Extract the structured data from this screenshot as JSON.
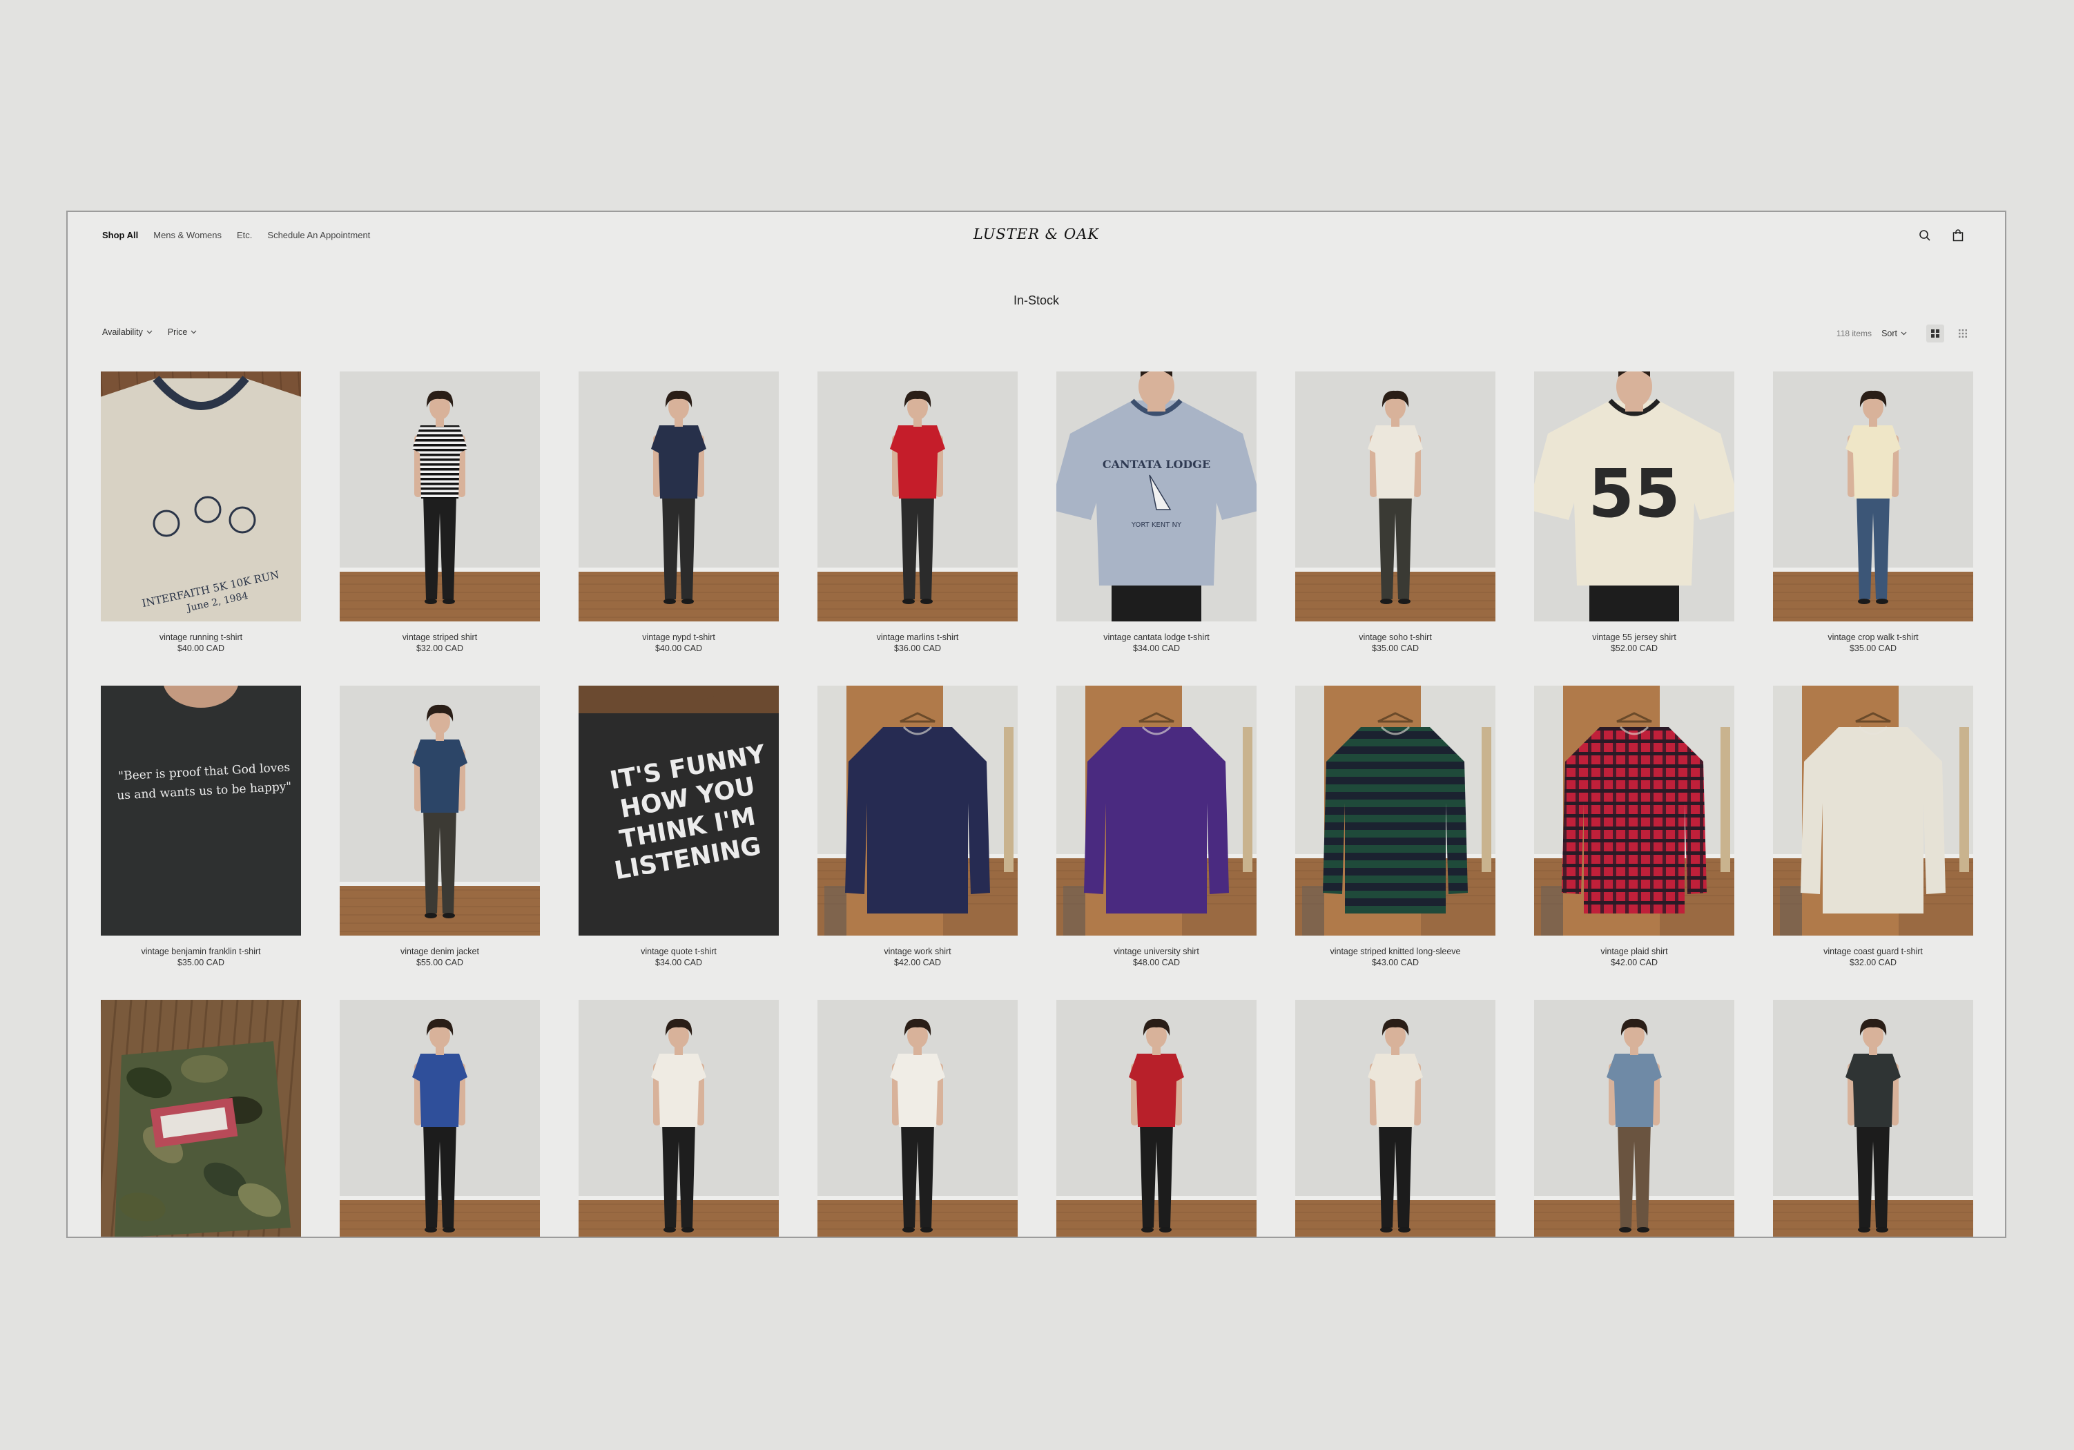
{
  "nav": {
    "items": [
      "Shop All",
      "Mens & Womens",
      "Etc.",
      "Schedule An Appointment"
    ],
    "logo": "LUSTER & OAK"
  },
  "header": {
    "icons": [
      "search-icon",
      "bag-icon"
    ]
  },
  "page": {
    "title": "In-Stock"
  },
  "toolbar": {
    "filters": [
      "Availability",
      "Price"
    ],
    "count": "118 items",
    "sort": "Sort",
    "views": [
      "grid-large-icon",
      "grid-small-icon"
    ]
  },
  "colors": {
    "wall": "#d9d9d6",
    "floor": "#9a6a42",
    "wood_board": "#8a6040",
    "post": "#b07a4a"
  },
  "products": [
    {
      "name": "vintage running t-shirt",
      "price": "$40.00 CAD",
      "scene": "flat",
      "shirt": "#d8d2c4",
      "trim": "#2b3548",
      "print": "INTERFAITH 5K 10K RUN",
      "print2": "June 2, 1984"
    },
    {
      "name": "vintage striped shirt",
      "price": "$32.00 CAD",
      "scene": "model",
      "shirt": "stripes",
      "pants": "#1e1e1e"
    },
    {
      "name": "vintage nypd t-shirt",
      "price": "$40.00 CAD",
      "scene": "model",
      "shirt": "#27304a",
      "pants": "#2b2b2b"
    },
    {
      "name": "vintage marlins t-shirt",
      "price": "$36.00 CAD",
      "scene": "model",
      "shirt": "#c51d2a",
      "pants": "#2b2b2b"
    },
    {
      "name": "vintage cantata lodge t-shirt",
      "price": "$34.00 CAD",
      "scene": "closeup",
      "shirt": "#a9b4c6",
      "trim": "#3c4f6e",
      "print": "CANTATA LODGE",
      "print2": "YORT KENT NY"
    },
    {
      "name": "vintage soho t-shirt",
      "price": "$35.00 CAD",
      "scene": "model",
      "shirt": "#ece7dc",
      "pants": "#3a3a34"
    },
    {
      "name": "vintage 55 jersey shirt",
      "price": "$52.00 CAD",
      "scene": "closeup",
      "shirt": "#ece6d4",
      "trim": "#222222",
      "print": "55",
      "print2": ""
    },
    {
      "name": "vintage crop walk t-shirt",
      "price": "$35.00 CAD",
      "scene": "model",
      "shirt": "#efe6c7",
      "pants": "#3c5677"
    },
    {
      "name": "vintage benjamin franklin t-shirt",
      "price": "$35.00 CAD",
      "scene": "flat-dark",
      "shirt": "#2e3030",
      "trim": "#2e3030",
      "print": "\"Beer is proof that God loves",
      "print2": "us and wants us to be happy\""
    },
    {
      "name": "vintage denim jacket",
      "price": "$55.00 CAD",
      "scene": "model",
      "shirt": "#2c4567",
      "pants": "#3c3a34"
    },
    {
      "name": "vintage quote t-shirt",
      "price": "$34.00 CAD",
      "scene": "flat-dark",
      "shirt": "#2b2b2b",
      "trim": "#2b2b2b",
      "print": "IT'S FUNNY HOW YOU",
      "print2": "THINK I'M LISTENING"
    },
    {
      "name": "vintage work shirt",
      "price": "$42.00 CAD",
      "scene": "hanger",
      "shirt": "#262b52"
    },
    {
      "name": "vintage university shirt",
      "price": "$48.00 CAD",
      "scene": "hanger",
      "shirt": "#4a2a80"
    },
    {
      "name": "vintage striped knitted long-sleeve",
      "price": "$43.00 CAD",
      "scene": "hanger",
      "shirt": "knit"
    },
    {
      "name": "vintage plaid shirt",
      "price": "$42.00 CAD",
      "scene": "hanger",
      "shirt": "plaid"
    },
    {
      "name": "vintage coast guard t-shirt",
      "price": "$32.00 CAD",
      "scene": "hanger",
      "shirt": "#e6e2d6"
    },
    {
      "name": "",
      "price": "",
      "scene": "camo",
      "shirt": "#4f5a3a"
    },
    {
      "name": "",
      "price": "",
      "scene": "model",
      "shirt": "#2f4f9a",
      "pants": "#1c1c1c"
    },
    {
      "name": "",
      "price": "",
      "scene": "model",
      "shirt": "#efebe3",
      "pants": "#1e1e1e"
    },
    {
      "name": "",
      "price": "",
      "scene": "model",
      "shirt": "#f0ede6",
      "pants": "#1e1e1e"
    },
    {
      "name": "",
      "price": "",
      "scene": "model",
      "shirt": "#b8202a",
      "pants": "#1c1c1c"
    },
    {
      "name": "",
      "price": "",
      "scene": "model",
      "shirt": "#ece6da",
      "pants": "#1c1c1c"
    },
    {
      "name": "",
      "price": "",
      "scene": "model",
      "shirt": "#6f8aa6",
      "pants": "#6a5440"
    },
    {
      "name": "",
      "price": "",
      "scene": "model",
      "shirt": "#2f3434",
      "pants": "#1c1c1c"
    }
  ]
}
